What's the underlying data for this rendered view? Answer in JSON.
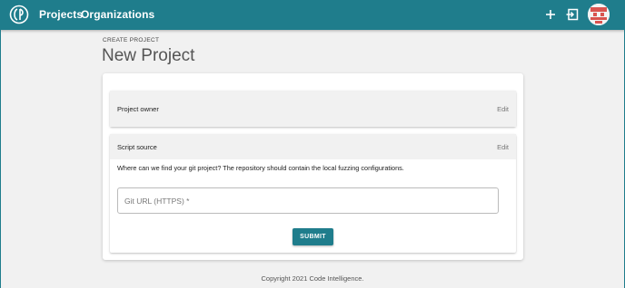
{
  "nav": {
    "projects": "Projects",
    "organizations": "Organizations",
    "icons": {
      "logo": "code-intelligence-logo",
      "add": "plus-icon",
      "login": "login-icon",
      "avatar": "user-avatar"
    }
  },
  "breadcrumb": "CREATE PROJECT",
  "title": "New Project",
  "owner_panel": {
    "label": "Project owner",
    "edit": "Edit"
  },
  "script_panel": {
    "label": "Script source",
    "edit": "Edit",
    "help": "Where can we find your git project? The repository should contain the local fuzzing configurations.",
    "url_placeholder": "Git URL (HTTPS) *",
    "url_value": "",
    "submit": "SUBMIT"
  },
  "footer": "Copyright 2021 Code Intelligence.",
  "colors": {
    "accent": "#1f7d8c",
    "background": "#f1f1f1"
  }
}
